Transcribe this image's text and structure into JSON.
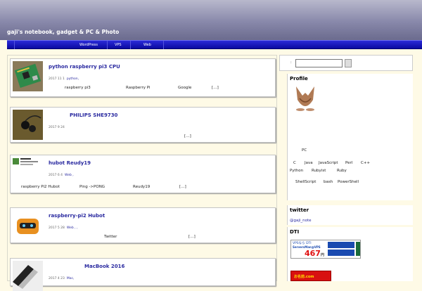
{
  "site": {
    "title": "gaji's notebook, gadget & PC & Photo"
  },
  "nav": {
    "items": [
      "WordPress",
      "VPS",
      "Web"
    ]
  },
  "posts": [
    {
      "title": "python  raspberry pi3  CPU",
      "date": "2017 11 1",
      "category": "python,",
      "excerpt": [
        "raspberry pi3",
        "Raspberry Pi",
        "Google",
        "[…]"
      ]
    },
    {
      "title": "PHILIPS      SHE9730",
      "date": "2017 9 24",
      "category": "",
      "excerpt": [
        "[…]"
      ]
    },
    {
      "title": "hubot          Reudy19",
      "date": "2017 6 4",
      "category": "Web  ,",
      "excerpt": [
        "raspberry Pi2 Hubot",
        "Ping ->PONG",
        "Reudy19",
        "[…]"
      ]
    },
    {
      "title": "raspberry-pi2  Hubot",
      "date": "2017 5 28",
      "category": "Web  ,  ,",
      "excerpt": [
        "Twitter",
        "[…]"
      ]
    },
    {
      "title": "MacBook 2016",
      "date": "2017 4 23",
      "category": "Mac,",
      "excerpt": []
    }
  ],
  "search": {
    "label": ":",
    "value": ""
  },
  "profile": {
    "title": "Profile",
    "lines": [
      [
        "PC"
      ],
      [
        "C",
        "Java",
        "JavaScript",
        "Perl",
        "C++"
      ],
      [
        "Python",
        "Rubyist",
        "Ruby"
      ],
      [
        "ShellScript",
        "bash",
        "PowerShell"
      ]
    ]
  },
  "twitter": {
    "title": "twitter",
    "handle": "@gaji_note"
  },
  "dti": {
    "title": "DTI",
    "ad_brand": "VPSなら DTI",
    "ad_product": "ServersMan@VPS",
    "ad_price": "467",
    "ad_yen": "円",
    "ad2": "お名前.com"
  }
}
